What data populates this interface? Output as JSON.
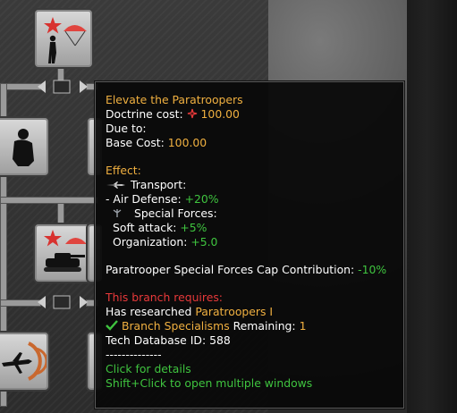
{
  "tooltip": {
    "title": "Elevate the Paratroopers",
    "doctrine_cost_label": "Doctrine cost:",
    "doctrine_cost_value": "100.00",
    "due_to_label": "Due to:",
    "base_cost_label": "Base Cost:",
    "base_cost_value": "100.00",
    "effect_header": "Effect:",
    "transport_label": "Transport:",
    "air_defense_label": "- Air Defense:",
    "air_defense_value": "+20%",
    "special_forces_label": "Special Forces:",
    "soft_attack_label": "Soft attack:",
    "soft_attack_value": "+5%",
    "organization_label": "Organization:",
    "organization_value": "+5.0",
    "cap_label": "Paratrooper Special Forces Cap Contribution:",
    "cap_value": "-10%",
    "requires_header": "This branch requires:",
    "has_researched_label": "Has researched",
    "has_researched_value": "Paratroopers I",
    "branch_specialisms_label": "Branch Specialisms",
    "remaining_label": "Remaining:",
    "remaining_value": "1",
    "tech_db_label": "Tech Database ID:",
    "tech_db_value": "588",
    "separator": "--------------",
    "click_details": "Click for details",
    "shift_click": "Shift+Click to open multiple windows"
  },
  "icons": {
    "star": "star-icon",
    "parachute": "parachute-icon",
    "soldier": "paratrooper-soldier-icon",
    "tank": "tank-icon",
    "plane": "transport-plane-icon",
    "checkmark": "checkmark-icon"
  },
  "colors": {
    "gold": "#f0b040",
    "green": "#3fc43f",
    "red": "#e8393a"
  }
}
